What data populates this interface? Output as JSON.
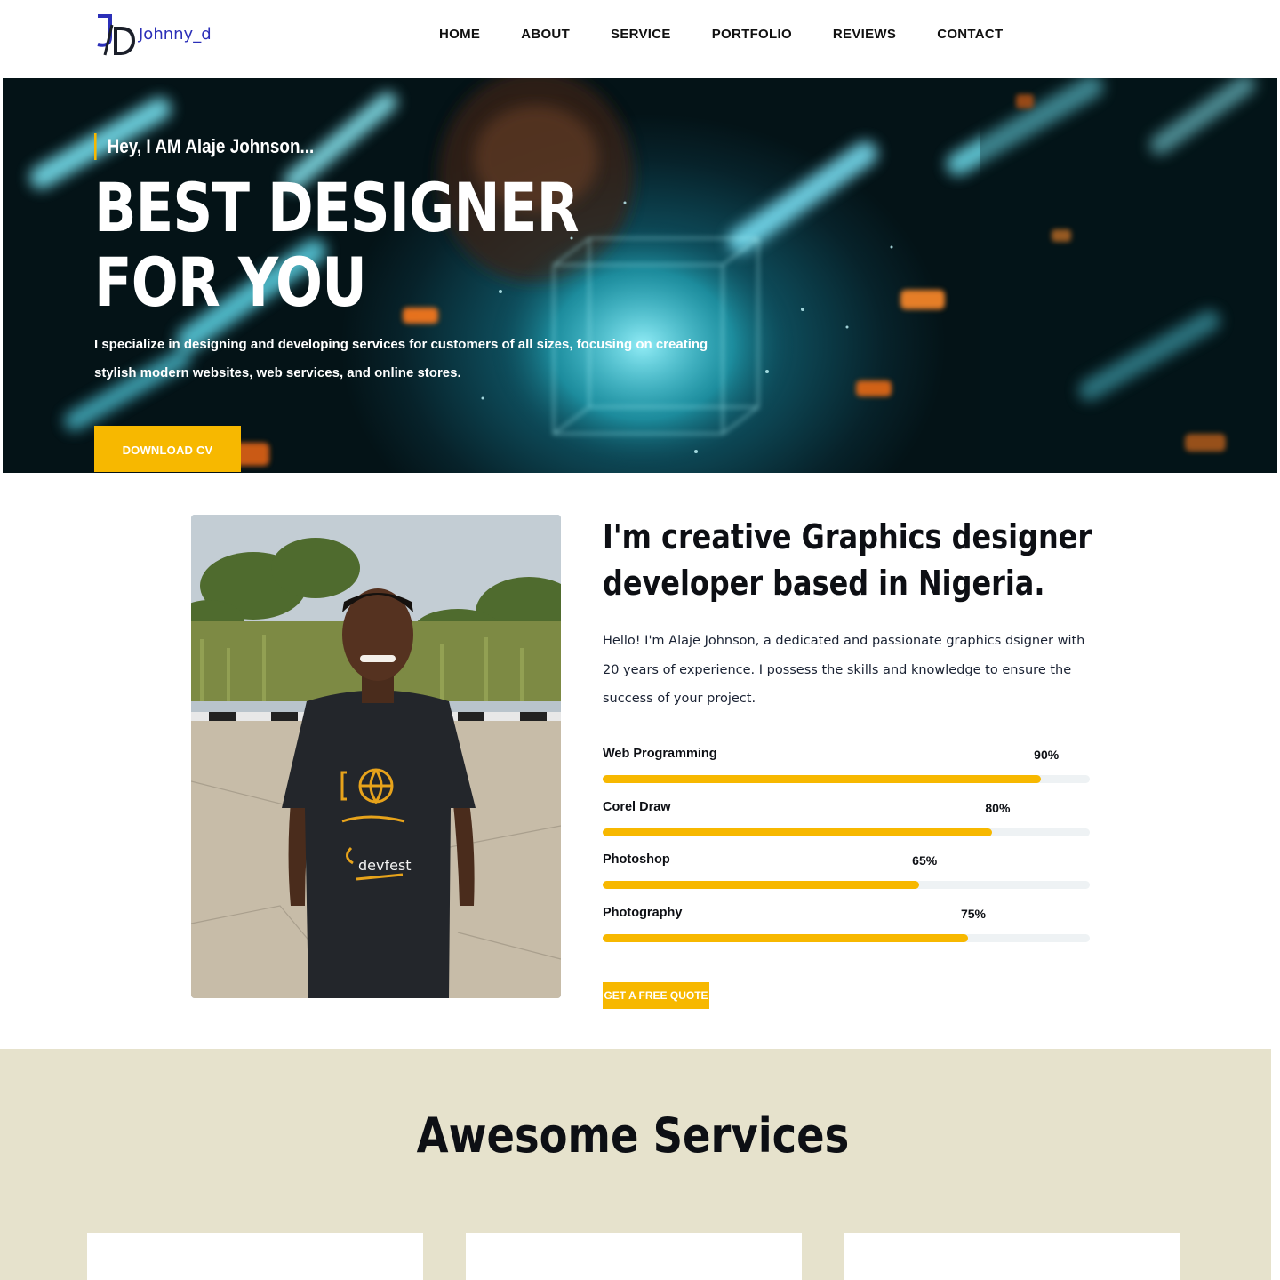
{
  "header": {
    "logo_text": "Johnny_d",
    "nav": [
      "HOME",
      "ABOUT",
      "SERVICE",
      "PORTFOLIO",
      "REVIEWS",
      "CONTACT"
    ]
  },
  "hero": {
    "tagline": "Hey, I AM Alaje Johnson...",
    "title_line1": "BEST DESIGNER",
    "title_line2": "FOR YOU",
    "description": "I specialize in designing and developing services for customers of all sizes, focusing on creating stylish modern websites, web services, and online stores.",
    "button_label": "DOWNLOAD CV"
  },
  "about": {
    "heading_line1": "I'm creative Graphics designer",
    "heading_line2": "developer based in Nigeria.",
    "text": "Hello! I'm Alaje Johnson, a dedicated and passionate graphics dsigner with 20 years of experience. I possess the skills and knowledge to ensure the success of your project.",
    "skills": [
      {
        "name": "Web Programming",
        "percent_label": "90%",
        "value": 90
      },
      {
        "name": "Corel Draw",
        "percent_label": "80%",
        "value": 80
      },
      {
        "name": "Photoshop",
        "percent_label": "65%",
        "value": 65
      },
      {
        "name": "Photography",
        "percent_label": "75%",
        "value": 75
      }
    ],
    "quote_button": "GET A FREE QUOTE",
    "photo_shirt_text": "devfest"
  },
  "services": {
    "title": "Awesome Services"
  },
  "colors": {
    "accent": "#f7b800",
    "services_bg": "#e6e2cc",
    "logo_blue": "#2b2fb8"
  }
}
